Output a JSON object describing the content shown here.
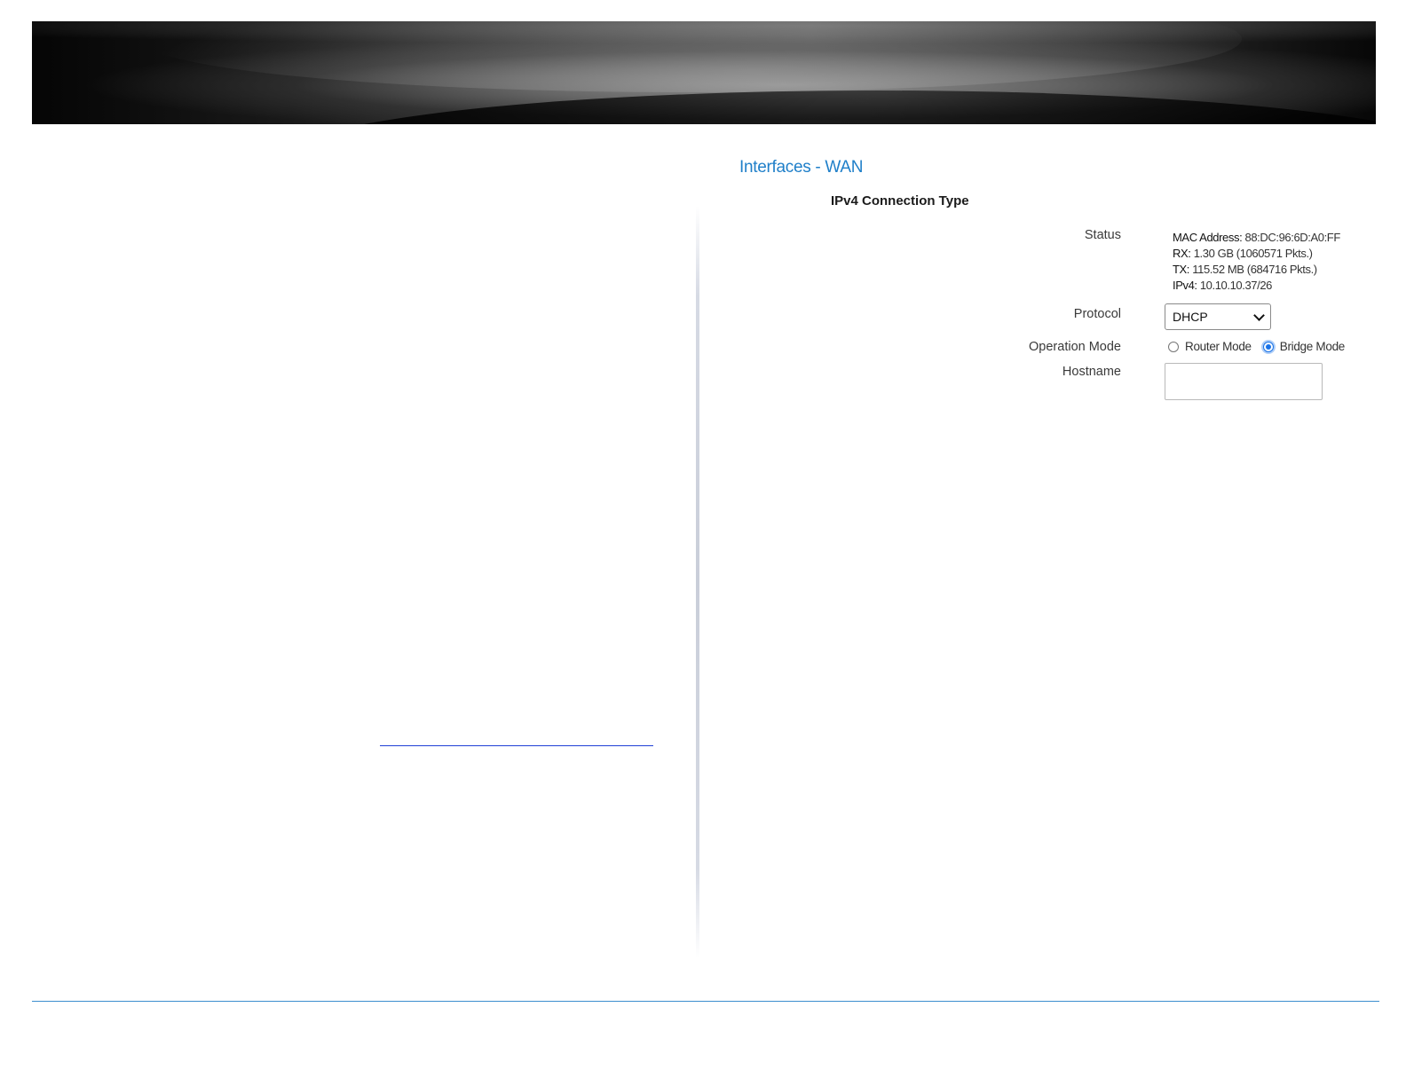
{
  "page": {
    "title": "Interfaces - WAN"
  },
  "section": {
    "heading": "IPv4 Connection Type"
  },
  "fields": {
    "status": {
      "label": "Status",
      "mac_key": "MAC Address:",
      "mac_value": "88:DC:96:6D:A0:FF",
      "rx_key": "RX:",
      "rx_value": "1.30 GB (1060571 Pkts.)",
      "tx_key": "TX:",
      "tx_value": "115.52 MB (684716 Pkts.)",
      "ipv4_key": "IPv4:",
      "ipv4_value": "10.10.10.37/26"
    },
    "protocol": {
      "label": "Protocol",
      "selected": "DHCP"
    },
    "operation_mode": {
      "label": "Operation Mode",
      "options": [
        {
          "label": "Router Mode",
          "checked": false
        },
        {
          "label": "Bridge Mode",
          "checked": true
        }
      ]
    },
    "hostname": {
      "label": "Hostname",
      "value": ""
    }
  },
  "colors": {
    "title_blue": "#1f7fc9",
    "link_blue": "#1f3fd6",
    "footer_rule": "#3d8fcf",
    "radio_checked": "#1a73e8"
  }
}
